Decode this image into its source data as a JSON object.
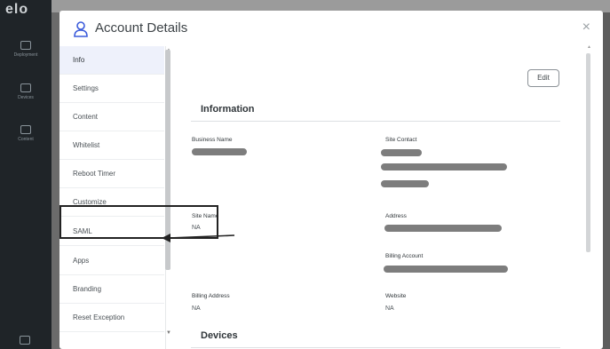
{
  "background_app": {
    "logo": "elo",
    "nav": [
      "Deployment",
      "Devices",
      "Content"
    ]
  },
  "modal": {
    "title": "Account Details",
    "close_label": "×"
  },
  "sidebar": {
    "items": [
      {
        "label": "Info",
        "active": true
      },
      {
        "label": "Settings"
      },
      {
        "label": "Content"
      },
      {
        "label": "Whitelist"
      },
      {
        "label": "Reboot Timer"
      },
      {
        "label": "Customize"
      },
      {
        "label": "SAML"
      },
      {
        "label": "Apps"
      },
      {
        "label": "Branding"
      },
      {
        "label": "Reset Exception"
      }
    ]
  },
  "content": {
    "edit_label": "Edit",
    "information_title": "Information",
    "devices_title": "Devices",
    "fields": {
      "business_name_label": "Business Name",
      "site_contact_label": "Site Contact",
      "site_name_label": "Site Name",
      "site_name_value": "NA",
      "address_label": "Address",
      "billing_account_label": "Billing Account",
      "billing_address_label": "Billing Address",
      "billing_address_value": "NA",
      "website_label": "Website",
      "website_value": "NA"
    }
  },
  "colors": {
    "active_nav_bg": "#eef1fb",
    "redaction": "#7d7d7d",
    "annotation": "#222222"
  }
}
